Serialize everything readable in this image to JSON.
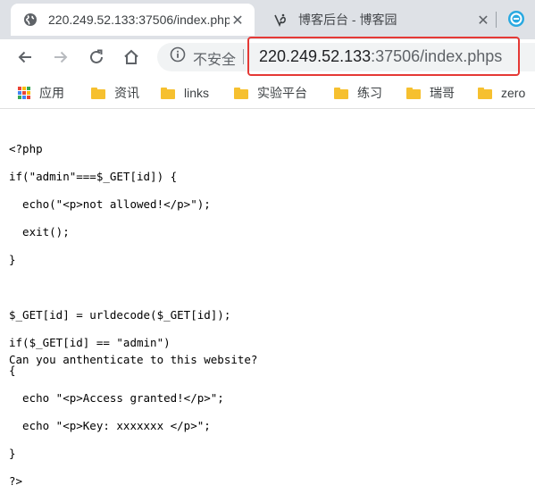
{
  "browser": {
    "tabs": [
      {
        "title": "220.249.52.133:37506/index.phps",
        "favicon": "globe-icon",
        "active": true
      },
      {
        "title": "博客后台 - 博客园",
        "favicon": "cnblogs-icon",
        "active": false
      }
    ],
    "close_glyph": "✕",
    "toolbar": {
      "back": "back-arrow-icon",
      "forward": "forward-arrow-icon",
      "reload": "reload-icon",
      "home": "home-icon"
    },
    "omnibox": {
      "security_label": "不安全",
      "url_host": "220.249.52.133",
      "url_rest": ":37506/index.phps"
    },
    "bookmarks": [
      {
        "label": "应用",
        "icon": "apps-grid-icon"
      },
      {
        "label": "资讯",
        "icon": "folder-icon"
      },
      {
        "label": "links",
        "icon": "folder-icon"
      },
      {
        "label": "实验平台",
        "icon": "folder-icon"
      },
      {
        "label": "练习",
        "icon": "folder-icon"
      },
      {
        "label": "瑞哥",
        "icon": "folder-icon"
      },
      {
        "label": "zero",
        "icon": "folder-icon"
      }
    ],
    "colors": {
      "tabstrip": "#dee1e6",
      "highlight": "#e53935",
      "folder": "#f6c02f"
    }
  },
  "page": {
    "code_lines": [
      "<?php",
      "if(\"admin\"===$_GET[id]) {",
      "  echo(\"<p>not allowed!</p>\");",
      "  exit();",
      "}",
      "",
      "$_GET[id] = urldecode($_GET[id]);",
      "if($_GET[id] == \"admin\")",
      "{",
      "  echo \"<p>Access granted!</p>\";",
      "  echo \"<p>Key: xxxxxxx </p>\";",
      "}",
      "?>"
    ],
    "question": "Can you anthenticate to this website?"
  }
}
